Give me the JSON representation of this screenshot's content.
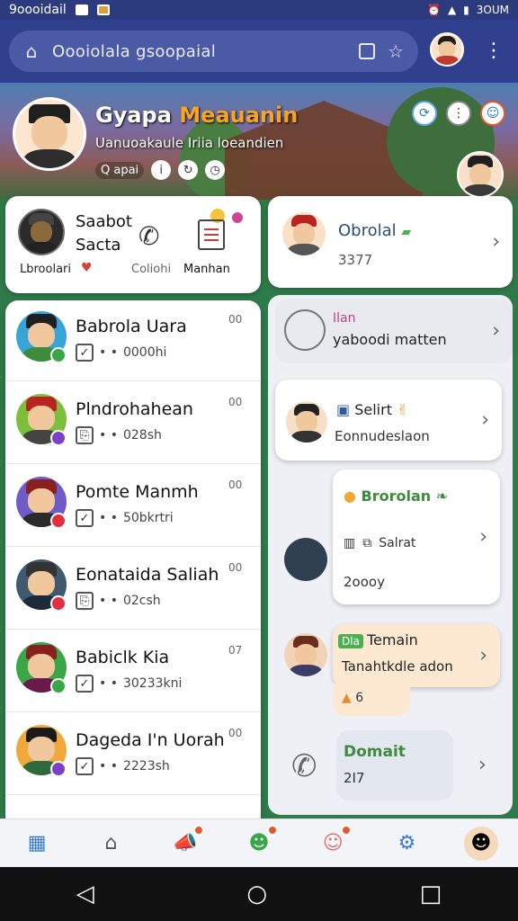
{
  "status_bar": {
    "app_name": "9oooidail",
    "time": "3OUM"
  },
  "url_bar": {
    "text": "Oooiolala gsoopaial"
  },
  "hero": {
    "title_part1": "Gyapa",
    "title_part2": "Meauanin",
    "subtitle": "Uanuoakaule Iriia loeandien",
    "pill_label": "Q apai"
  },
  "top_card": {
    "name_line1": "Saabot",
    "name_line2": "Sacta",
    "label_left": "Lbroolari",
    "label_mid": "Coliohi",
    "label_right": "Manhan"
  },
  "contacts": [
    {
      "name": "Babrola Uara",
      "meta": "0000hi",
      "time": "00",
      "badge": "#3aa648"
    },
    {
      "name": "Plndrohahean",
      "meta": "028sh",
      "time": "00",
      "badge": "#7d3fc5"
    },
    {
      "name": "Pomte Manmh",
      "meta": "50bkrtri",
      "time": "00",
      "badge": "#e0303f"
    },
    {
      "name": "Eonataida Saliah",
      "meta": "02csh",
      "time": "00",
      "badge": "#e0303f"
    },
    {
      "name": "Babiclk Kia",
      "meta": "30233kni",
      "time": "07",
      "badge": "#3aa648"
    },
    {
      "name": "Dageda I'n Uorah",
      "meta": "2223sh",
      "time": "00",
      "badge": "#7d3fc5"
    }
  ],
  "right_cards": {
    "c1": {
      "title": "Obrolal",
      "value": "3377"
    },
    "c2": {
      "title": "Ilan",
      "value": "yaboodi matten"
    },
    "c3": {
      "title": "Selirt",
      "value": "Eonnudeslaon"
    },
    "c4": {
      "title": "Brorolan",
      "mid": "Salrat",
      "value": "2oooy"
    },
    "c5": {
      "tag": "Dla",
      "title": "Temain",
      "value": "Tanahtkdle adon",
      "sub": "6"
    },
    "c6": {
      "title": "Domait",
      "value": "2I7"
    }
  },
  "colors": {
    "accent": "#f5a523",
    "header": "#30408e",
    "status": "#2c3a7e",
    "green": "#3c8c3c"
  }
}
